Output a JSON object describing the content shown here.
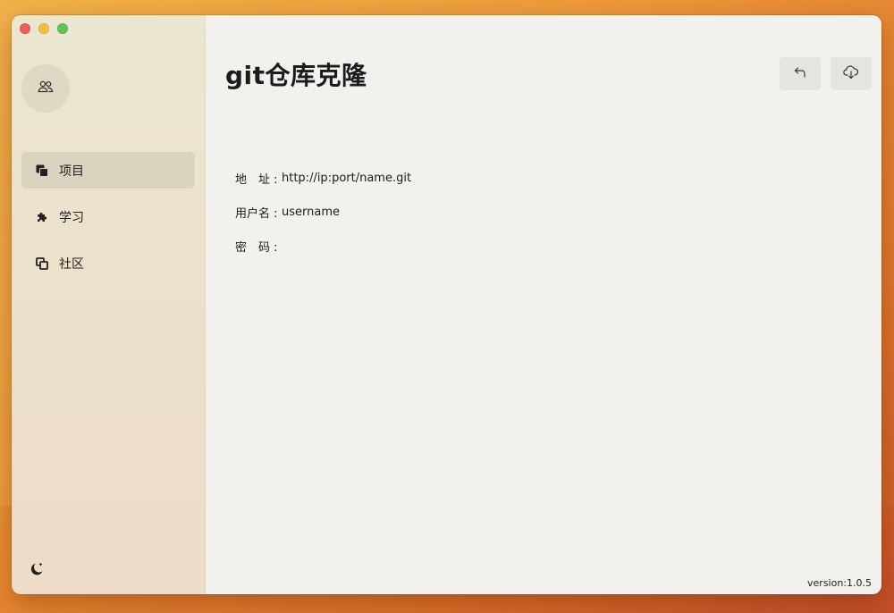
{
  "window": {
    "title": "git仓库克隆"
  },
  "sidebar": {
    "avatar_icon": "users-icon",
    "items": [
      {
        "label": "项目",
        "icon": "stack-icon",
        "active": true
      },
      {
        "label": "学习",
        "icon": "puzzle-icon",
        "active": false
      },
      {
        "label": "社区",
        "icon": "copy-icon",
        "active": false
      }
    ],
    "theme_icon": "moon-star-icon"
  },
  "toolbar": {
    "back_icon": "arrow-back-icon",
    "download_icon": "cloud-download-icon"
  },
  "form": {
    "address": {
      "label": "地　址 :",
      "value": "http://ip:port/name.git"
    },
    "username": {
      "label": "用户名 :",
      "value": "username"
    },
    "password": {
      "label": "密　码 :",
      "value": ""
    }
  },
  "footer": {
    "version": "version:1.0.5"
  },
  "colors": {
    "sidebar_bg": "#ebe4cd",
    "main_bg": "#f3f1ed",
    "active_item": "#d8d4c0",
    "button_bg": "#e6e4e0"
  }
}
